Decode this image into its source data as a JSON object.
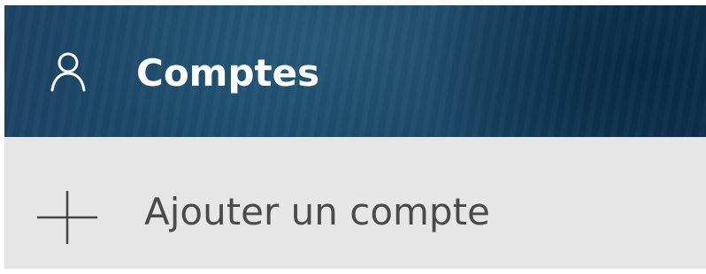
{
  "header": {
    "icon": "person-icon",
    "title": "Comptes",
    "background_color": "#1b4a6a"
  },
  "add_account": {
    "icon": "plus-icon",
    "label": "Ajouter un compte",
    "background_color": "#e6e6e6"
  }
}
